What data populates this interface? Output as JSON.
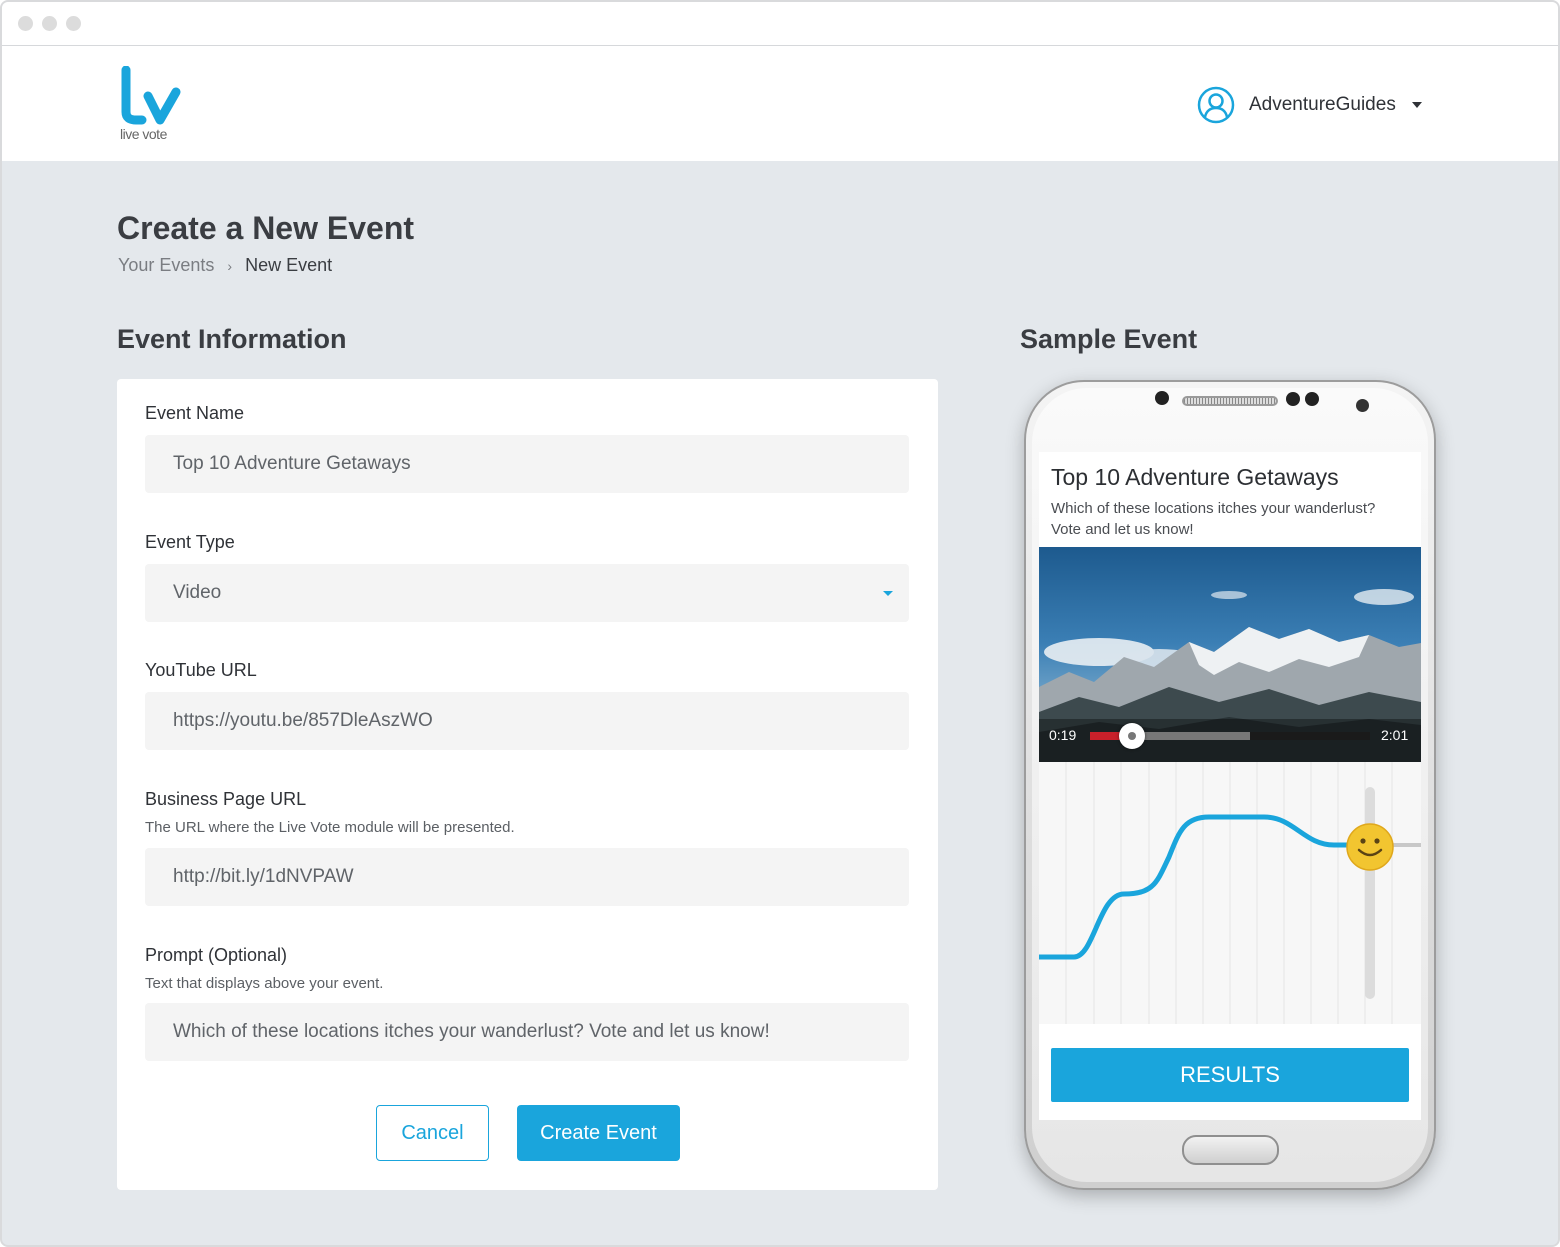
{
  "app": {
    "logo_text": "live vote",
    "user_name": "AdventureGuides"
  },
  "page": {
    "title": "Create a New Event",
    "breadcrumb": {
      "parent": "Your Events",
      "separator": "›",
      "current": "New Event"
    }
  },
  "form": {
    "section_title": "Event Information",
    "event_name": {
      "label": "Event Name",
      "value": "Top 10 Adventure Getaways"
    },
    "event_type": {
      "label": "Event Type",
      "value": "Video"
    },
    "youtube_url": {
      "label": "YouTube URL",
      "value": "https://youtu.be/857DleAszWO"
    },
    "business_url": {
      "label": "Business Page URL",
      "help": "The URL where the Live Vote module will be presented.",
      "value": "http://bit.ly/1dNVPAW"
    },
    "prompt": {
      "label": "Prompt (Optional)",
      "help": "Text that displays above your event.",
      "value": "Which of these locations itches your wanderlust? Vote and let us know!"
    },
    "cancel_label": "Cancel",
    "create_label": "Create Event"
  },
  "sample": {
    "section_title": "Sample Event",
    "title": "Top 10 Adventure Getaways",
    "prompt": "Which of these locations itches your wanderlust? Vote and let us know!",
    "time_current": "0:19",
    "time_total": "2:01",
    "results_label": "RESULTS"
  },
  "colors": {
    "accent": "#1aa5dc",
    "background": "#e4e8ec",
    "progress_red": "#c8202a",
    "smiley": "#f2c530"
  },
  "icons": {
    "user": "user-circle-icon",
    "dropdown": "caret-down-icon",
    "smiley": "smiley-face-icon"
  }
}
